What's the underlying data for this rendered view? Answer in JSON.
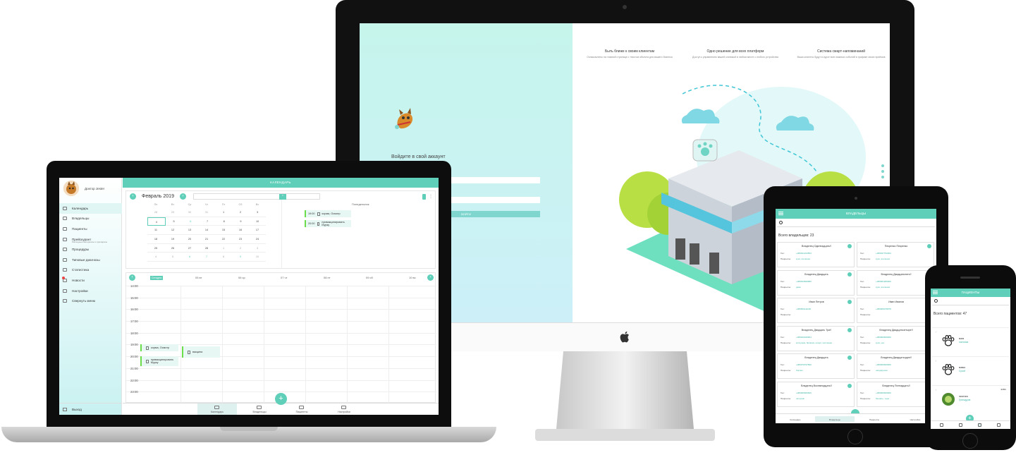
{
  "imac": {
    "login_title": "Войдите в свой аккаунт",
    "login_button": "ВОЙТИ",
    "features": [
      {
        "title": "Быть ближе к своим клиентам",
        "desc": "Ознакомлены на главной странице с текстом объекта для вашего бизнеса"
      },
      {
        "title": "Одно решение для всех платформ",
        "desc": "Доступ к управлению вашей клиникой в любом месте с любого устройства"
      },
      {
        "title": "Система смарт-напоминаний",
        "desc": "Ваши клиенты будут в курсе всех важных событий в графике своих приёмов"
      }
    ]
  },
  "laptop": {
    "topbar_title": "КАЛЕНДАРЬ",
    "doctor_name": "Доктор Jester",
    "menu": [
      {
        "label": "Календарь",
        "icon": "calendar-icon",
        "active": true
      },
      {
        "label": "Владельцы",
        "icon": "owners-icon"
      },
      {
        "label": "Пациенты",
        "icon": "patients-icon"
      },
      {
        "label": "Прейскурант",
        "icon": "pricelist-icon",
        "sub": "Расходные материалы и препараты"
      },
      {
        "label": "Процедуры",
        "icon": "procedures-icon"
      },
      {
        "label": "Типовые диагнозы",
        "icon": "diagnoses-icon"
      },
      {
        "label": "Статистика",
        "icon": "statistics-icon"
      },
      {
        "label": "Новости",
        "icon": "news-icon",
        "badge": true
      },
      {
        "label": "Настройки",
        "icon": "settings-icon"
      },
      {
        "label": "Свернуть меню",
        "icon": "collapse-icon"
      }
    ],
    "logout_label": "Выход",
    "month_label": "Февраль 2019",
    "weekdays": [
      "Пн",
      "Вт",
      "Ср",
      "Чт",
      "Пт",
      "Сб",
      "Вс"
    ],
    "mini_calendar": [
      [
        "28",
        "29",
        "30",
        "31",
        "1",
        "2",
        "3"
      ],
      [
        "4",
        "5",
        "6",
        "7",
        "8",
        "9",
        "10"
      ],
      [
        "11",
        "12",
        "13",
        "14",
        "15",
        "16",
        "17"
      ],
      [
        "18",
        "19",
        "20",
        "21",
        "22",
        "23",
        "24"
      ],
      [
        "25",
        "26",
        "27",
        "28",
        "1",
        "2",
        "3"
      ],
      [
        "4",
        "5",
        "6",
        "7",
        "8",
        "9",
        "10"
      ]
    ],
    "day_label": "Понедельник",
    "day_appointments": [
      {
        "time": "19:00",
        "title": "корма, Осмотр"
      },
      {
        "time": "20:00",
        "title": "привакцинировать Мурку"
      }
    ],
    "week_today": "Сегодня",
    "week_days": [
      "05 вт",
      "06 ср",
      "07 чт",
      "08 пт",
      "09 сб",
      "10 вс"
    ],
    "times": [
      "14:00",
      "15:00",
      "16:00",
      "17:00",
      "18:00",
      "19:00",
      "20:00",
      "21:00",
      "22:00",
      "23:00"
    ],
    "week_events": [
      {
        "title": "корма, Осмотр"
      },
      {
        "title": "привакцинировать Мурку"
      },
      {
        "title": "вакцина"
      }
    ],
    "bottom_tabs": [
      "Календарь",
      "Владельцы",
      "Пациенты",
      "Настройки"
    ],
    "fab": "+"
  },
  "tablet": {
    "title": "ВЛАДЕЛЬЦЫ",
    "count_text": "Всего владельцев: 23",
    "owners": [
      {
        "name": "Владелец Одиннадцать!!",
        "phone": "+380931234553",
        "patients": "кузя, ягелинка"
      },
      {
        "name": "Пекренко Пекренко",
        "phone": "+380937752004",
        "patients": "кузя, ягелинка"
      },
      {
        "name": "Владелец Двадцать",
        "phone": "+380633699980",
        "patients": "джек"
      },
      {
        "name": "Владелец Двадцатьпять!!",
        "phone": "+380961280000",
        "patients": "кузя, ягелинка"
      },
      {
        "name": "Иван Петров",
        "phone": "+380669111130",
        "patients": ""
      },
      {
        "name": "Иван Иванов",
        "phone": "+380966078978",
        "patients": ""
      },
      {
        "name": "Владелец Двадцать Три!!",
        "phone": "+380940049904",
        "patients": "копчушка, бривчик, шпорт, копчишка"
      },
      {
        "name": "Владелец Двадцатьчетыре!!",
        "phone": "+380966666666",
        "patients": "кузя, уез"
      },
      {
        "name": "Владелец Двадцать",
        "phone": "+380979797896",
        "patients": "борчик"
      },
      {
        "name": "Владелец Двадцатьодин!!",
        "phone": "+380966666666",
        "patients": "шинджушка"
      },
      {
        "name": "Владелец Восемнадцать!!",
        "phone": "+380966666666",
        "patients": "шпорчик"
      },
      {
        "name": "Владелец Пятнадцать!!",
        "phone": "+380966666666",
        "patients": "бешаль, тырк"
      }
    ],
    "label_phone": "Тел:",
    "label_patients": "Пациенты:",
    "bottom_tabs": [
      "Календарь",
      "Владельцы",
      "Пациенты",
      "Настройки"
    ]
  },
  "phone": {
    "title": "ПАЦИЕНТЫ",
    "count_text": "Всего пациентов: 47",
    "patients": [
      {
        "name": "мася",
        "owner": "пологикa",
        "tag": ""
      },
      {
        "name": "мавка",
        "owner": "Сухой",
        "tag": ""
      },
      {
        "name": "экзотика",
        "owner": "Гринщуров",
        "tag": "Ж/ВС"
      }
    ],
    "fab": "+"
  }
}
